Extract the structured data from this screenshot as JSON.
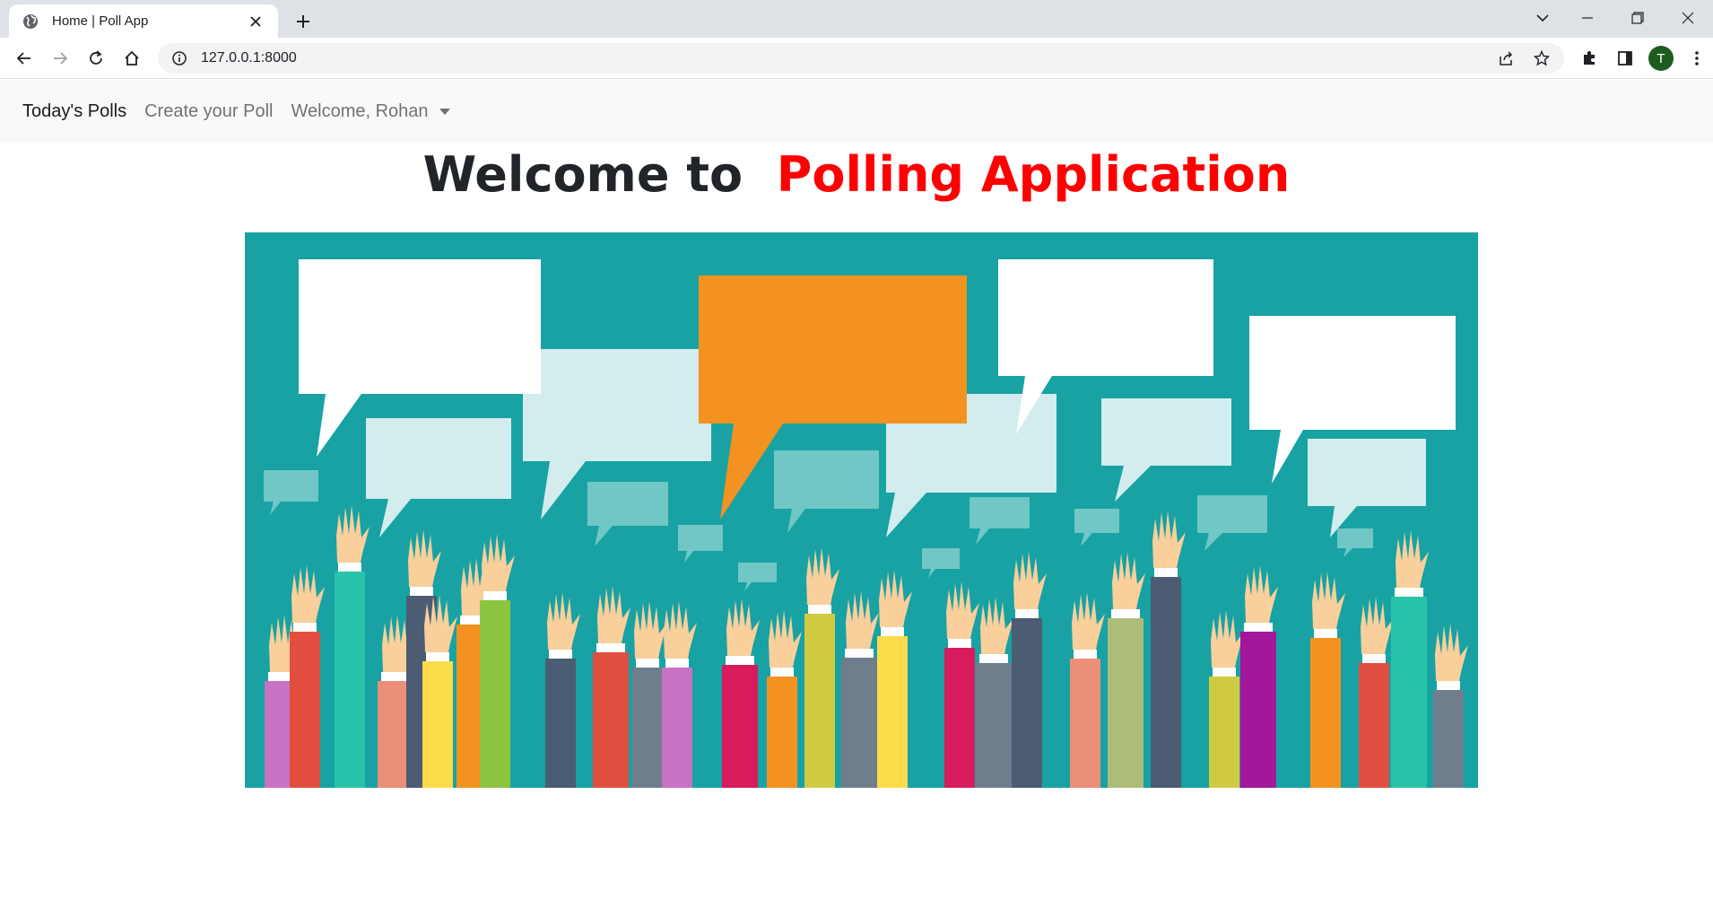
{
  "browser": {
    "tab_title": "Home | Poll App",
    "url": "127.0.0.1:8000",
    "profile_initial": "T"
  },
  "navbar": {
    "brand": "Today's Polls",
    "create_link": "Create your Poll",
    "user_menu": "Welcome, Rohan"
  },
  "hero": {
    "title_prefix": "Welcome to",
    "title_accent": "Polling Application",
    "accent_color": "#ff0000",
    "image_background": "#18a2a3",
    "image_description_icon": "raised-hands-speech-bubbles-illustration"
  }
}
